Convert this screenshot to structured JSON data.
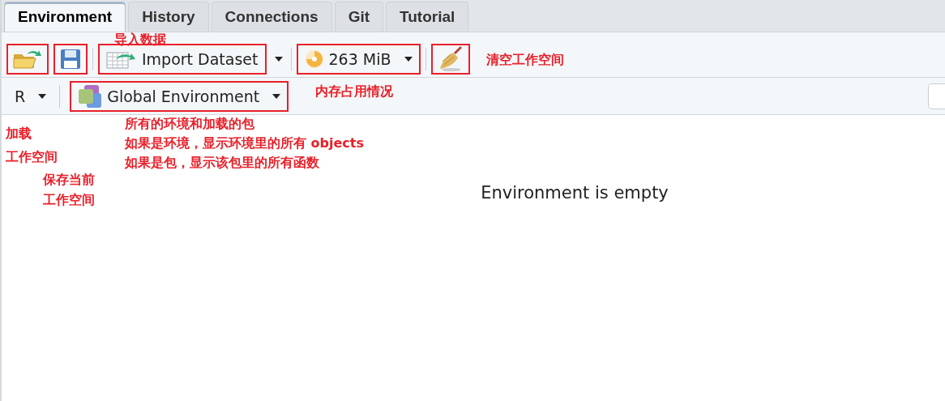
{
  "tabs": [
    {
      "label": "Environment",
      "selected": true
    },
    {
      "label": "History",
      "selected": false
    },
    {
      "label": "Connections",
      "selected": false
    },
    {
      "label": "Git",
      "selected": false
    },
    {
      "label": "Tutorial",
      "selected": false
    }
  ],
  "toolbar": {
    "load_button": {
      "highlighted": true
    },
    "save_button": {
      "highlighted": true
    },
    "import_button": {
      "label": "Import Dataset",
      "highlighted": true
    },
    "memory_button": {
      "label": "263 MiB",
      "level": 0.75,
      "highlighted": true
    },
    "clear_button": {
      "highlighted": true
    }
  },
  "env_bar": {
    "language": "R",
    "environment": {
      "label": "Global Environment",
      "highlighted": true
    }
  },
  "empty_message": "Environment is empty",
  "annotations": [
    {
      "lines": [
        "导入数据"
      ]
    },
    {
      "lines": [
        "清空工作空间"
      ]
    },
    {
      "lines": [
        "内存占用情况"
      ]
    },
    {
      "lines": [
        "加载",
        "工作空间"
      ]
    },
    {
      "lines": [
        "所有的环境和加载的包",
        "如果是环境，显示环境里的所有 objects",
        "如果是包，显示该包里的所有函数"
      ]
    },
    {
      "lines": [
        "保存当前",
        "工作空间"
      ]
    }
  ]
}
